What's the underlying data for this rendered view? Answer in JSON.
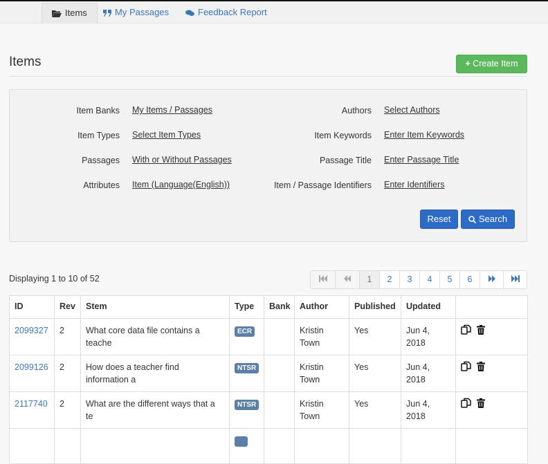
{
  "tabs": [
    {
      "label": "Items",
      "icon": "folder-open-icon",
      "active": true
    },
    {
      "label": "My Passages",
      "icon": "quote-icon",
      "active": false
    },
    {
      "label": "Feedback Report",
      "icon": "comments-icon",
      "active": false
    }
  ],
  "page": {
    "title": "Items",
    "create_label": "Create Item"
  },
  "filters": {
    "left": [
      {
        "label": "Item Banks",
        "value": "My Items / Passages"
      },
      {
        "label": "Item Types",
        "value": "Select Item Types"
      },
      {
        "label": "Passages",
        "value": "With or Without Passages"
      },
      {
        "label": "Attributes",
        "value": "Item (Language(English))"
      }
    ],
    "right": [
      {
        "label": "Authors",
        "value": "Select Authors"
      },
      {
        "label": "Item Keywords",
        "value": "Enter Item Keywords"
      },
      {
        "label": "Passage Title",
        "value": "Enter Passage Title"
      },
      {
        "label": "Item / Passage Identifiers",
        "value": "Enter Identifiers"
      }
    ],
    "reset_label": "Reset",
    "search_label": "Search"
  },
  "results": {
    "display_text": "Displaying 1 to 10 of 52"
  },
  "pagination": {
    "pages": [
      "1",
      "2",
      "3",
      "4",
      "5",
      "6"
    ],
    "current": "1"
  },
  "table": {
    "headers": [
      "ID",
      "Rev",
      "Stem",
      "Type",
      "Bank",
      "Author",
      "Published",
      "Updated",
      ""
    ],
    "rows": [
      {
        "id": "2099327",
        "rev": "2",
        "stem": "What core data file contains a teache",
        "type": "ECR",
        "bank": "",
        "author": "Kristin Town",
        "published": "Yes",
        "updated": "Jun 4, 2018"
      },
      {
        "id": "2099126",
        "rev": "2",
        "stem": "How does a teacher find information a",
        "type": "NTSR",
        "bank": "",
        "author": "Kristin Town",
        "published": "Yes",
        "updated": "Jun 4, 2018"
      },
      {
        "id": "2117740",
        "rev": "2",
        "stem": "What are the different ways that a te",
        "type": "NTSR",
        "bank": "",
        "author": "Kristin Town",
        "published": "Yes",
        "updated": "Jun 4, 2018"
      }
    ]
  },
  "colors": {
    "link": "#3a78b8",
    "success": "#5cb85c",
    "primary": "#2d6bc8",
    "badge": "#5b7fa6"
  }
}
